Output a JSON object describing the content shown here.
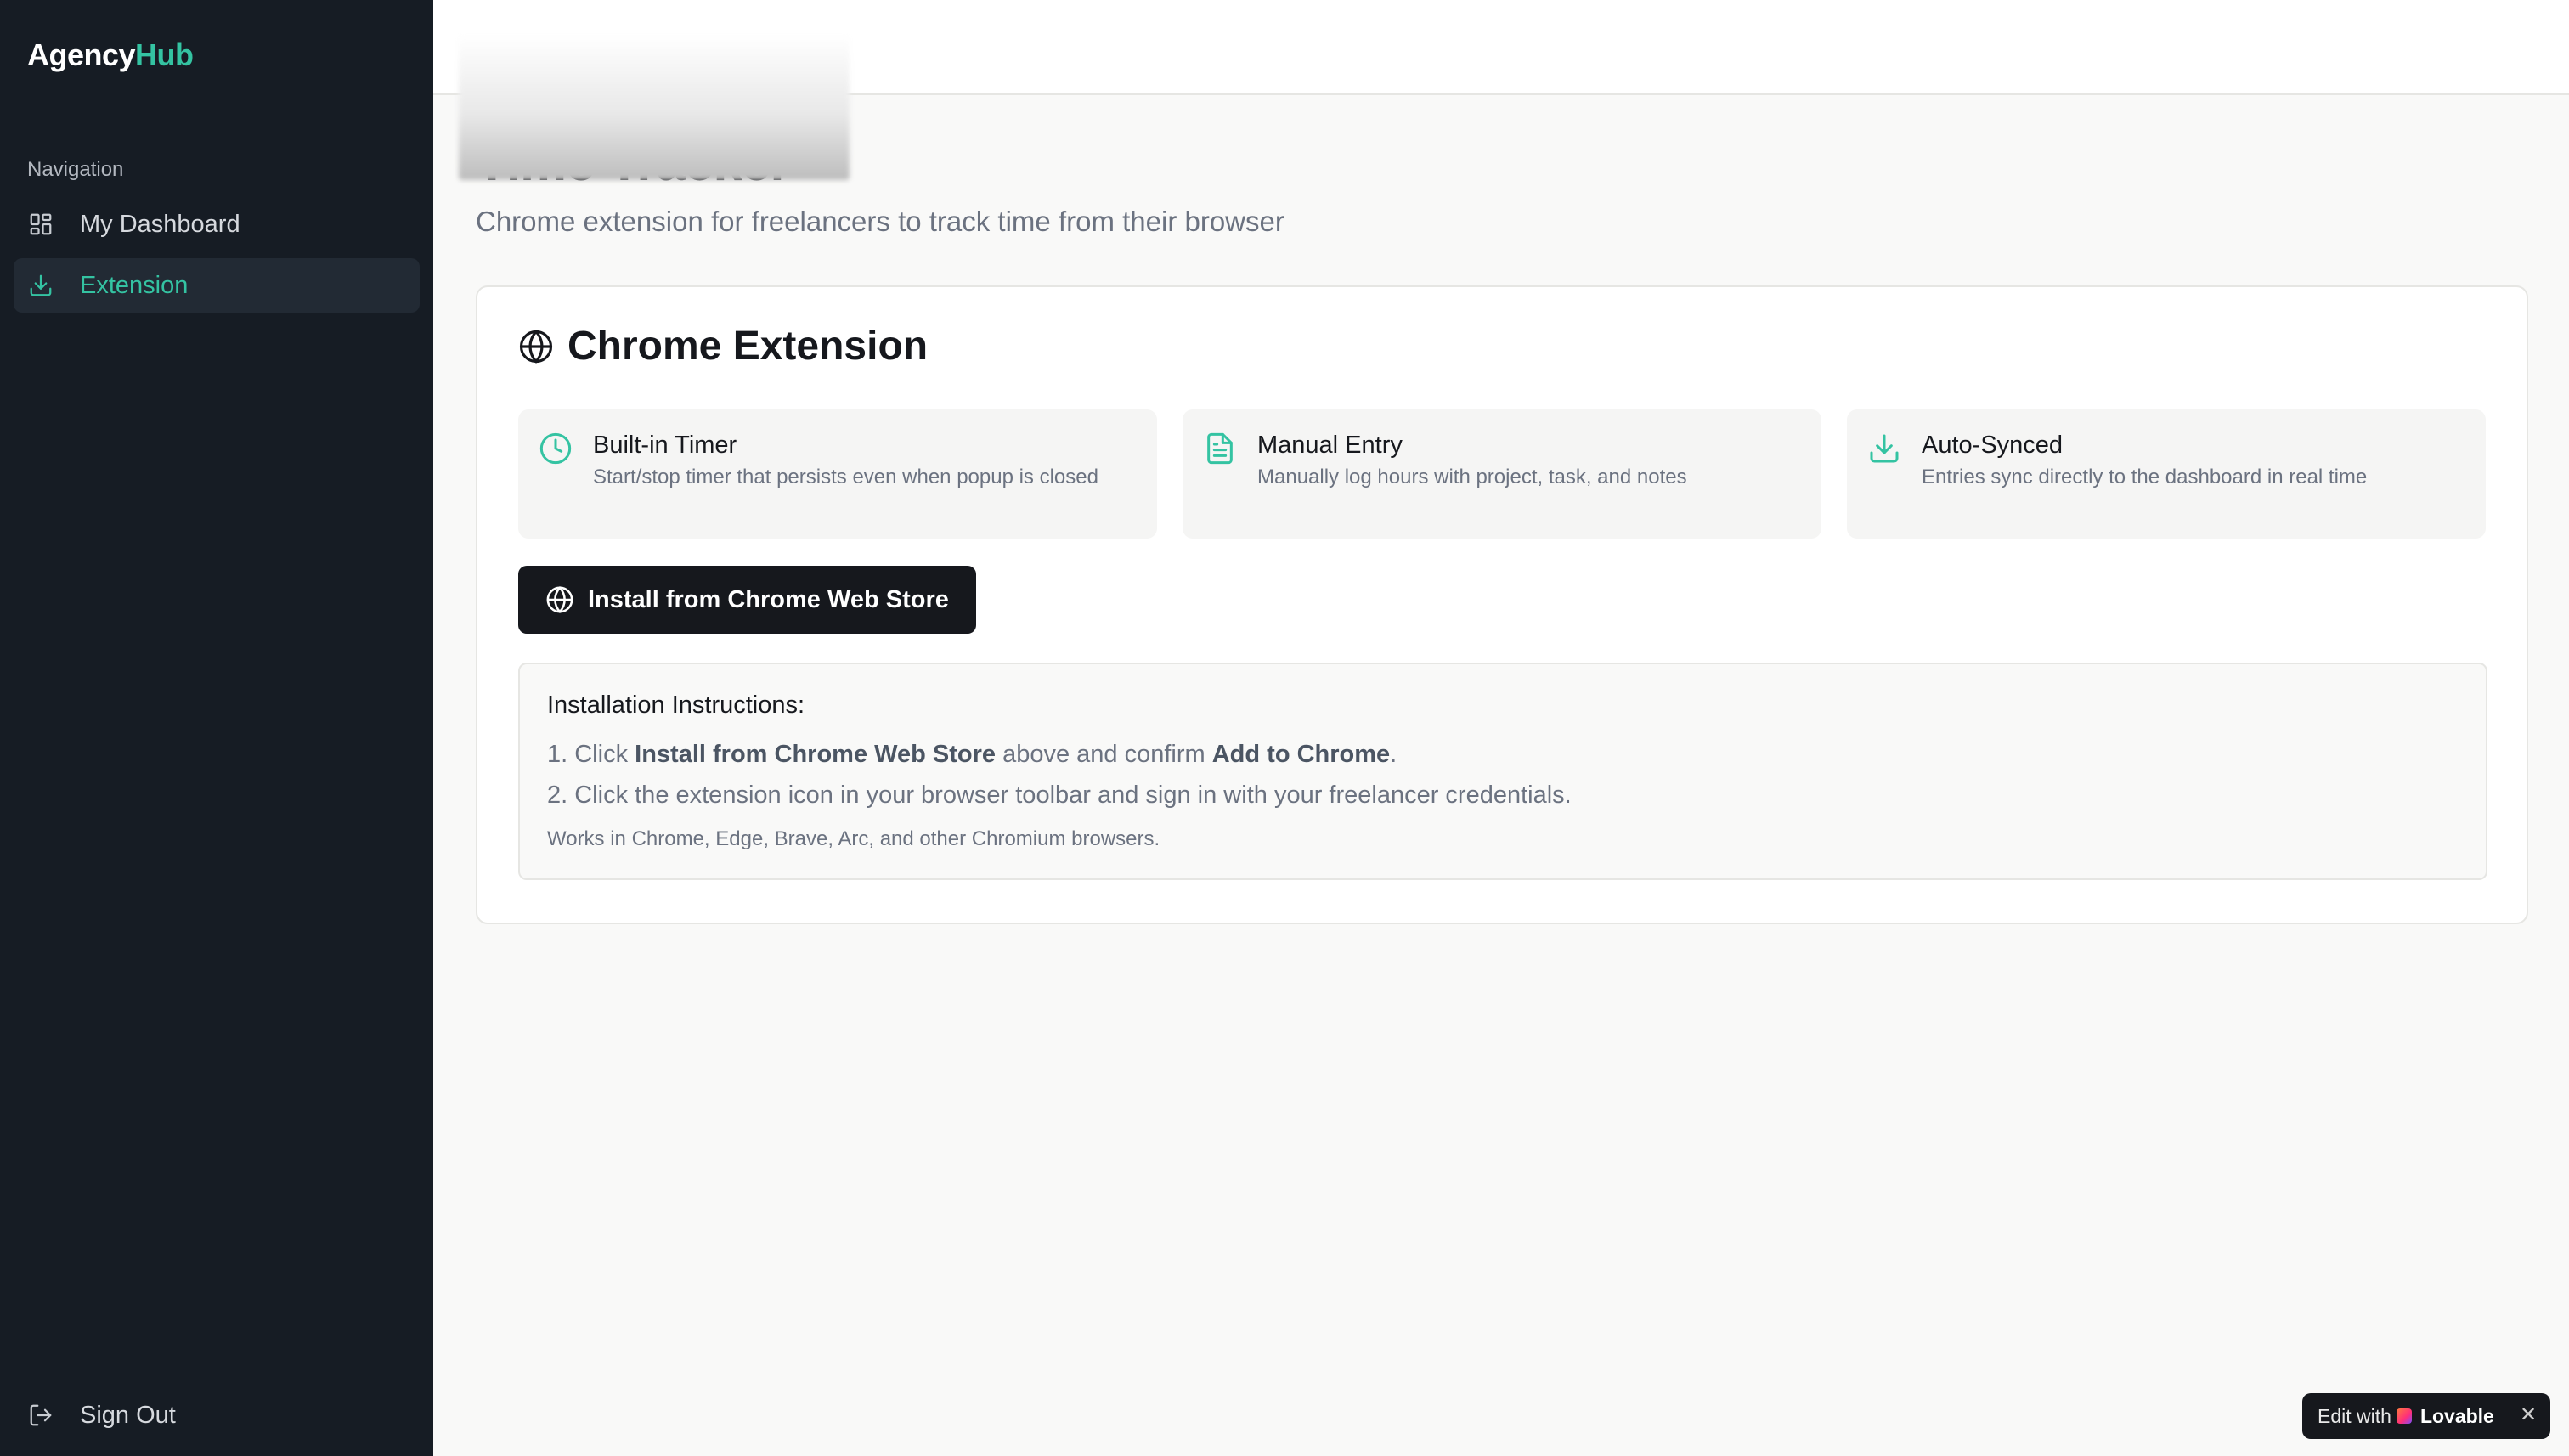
{
  "app": {
    "logo_part1": "Agency",
    "logo_part2": "Hub"
  },
  "sidebar": {
    "section_label": "Navigation",
    "items": [
      {
        "label": "My Dashboard",
        "icon": "grid-icon"
      },
      {
        "label": "Extension",
        "icon": "download-icon",
        "active": true
      }
    ],
    "sign_out": "Sign Out"
  },
  "page": {
    "title": "Time Tracker",
    "subtitle": "Chrome extension for freelancers to track time from their browser"
  },
  "card": {
    "title": "Chrome Extension",
    "features": [
      {
        "title": "Built-in Timer",
        "desc": "Start/stop timer that persists even when popup is closed",
        "icon": "clock-icon"
      },
      {
        "title": "Manual Entry",
        "desc": "Manually log hours with project, task, and notes",
        "icon": "document-icon"
      },
      {
        "title": "Auto-Synced",
        "desc": "Entries sync directly to the dashboard in real time",
        "icon": "download-icon"
      }
    ],
    "install_button": "Install from Chrome Web Store",
    "instructions": {
      "title": "Installation Instructions:",
      "step1_prefix": "1. Click",
      "step1_bold1": "Install from Chrome Web Store",
      "step1_mid": "above and confirm",
      "step1_bold2": "Add to Chrome",
      "step1_suffix": ".",
      "step2": "2. Click the extension icon in your browser toolbar and sign in with your freelancer credentials.",
      "note": "Works in Chrome, Edge, Brave, Arc, and other Chromium browsers."
    }
  },
  "badge": {
    "prefix": "Edit with",
    "brand": "Lovable",
    "close": "✕"
  },
  "colors": {
    "accent": "#34c3a2",
    "sidebar_bg": "#161c24",
    "button_bg": "#16181d"
  }
}
